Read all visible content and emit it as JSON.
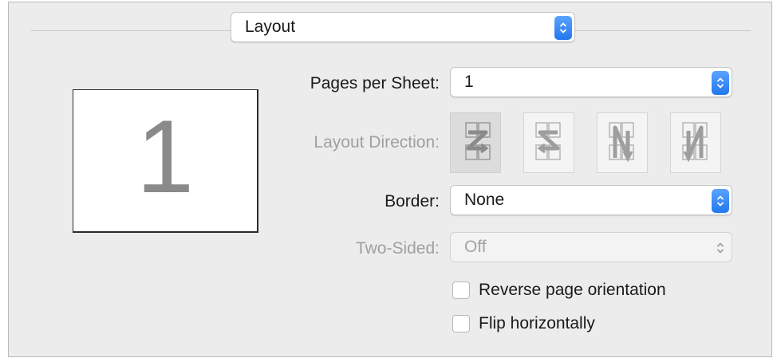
{
  "section_popup": {
    "selected": "Layout"
  },
  "preview": {
    "page_number": "1"
  },
  "pages_per_sheet": {
    "label": "Pages per Sheet:",
    "value": "1"
  },
  "layout_direction": {
    "label": "Layout Direction:",
    "options": [
      "z-right",
      "s-left",
      "n-down-left",
      "n-down-right"
    ],
    "selected_index": 0
  },
  "border": {
    "label": "Border:",
    "value": "None"
  },
  "two_sided": {
    "label": "Two-Sided:",
    "value": "Off"
  },
  "options": {
    "reverse": {
      "label": "Reverse page orientation",
      "checked": false
    },
    "flip": {
      "label": "Flip horizontally",
      "checked": false
    }
  },
  "colors": {
    "accent": "#2f80ff",
    "panel": "#ececec"
  }
}
